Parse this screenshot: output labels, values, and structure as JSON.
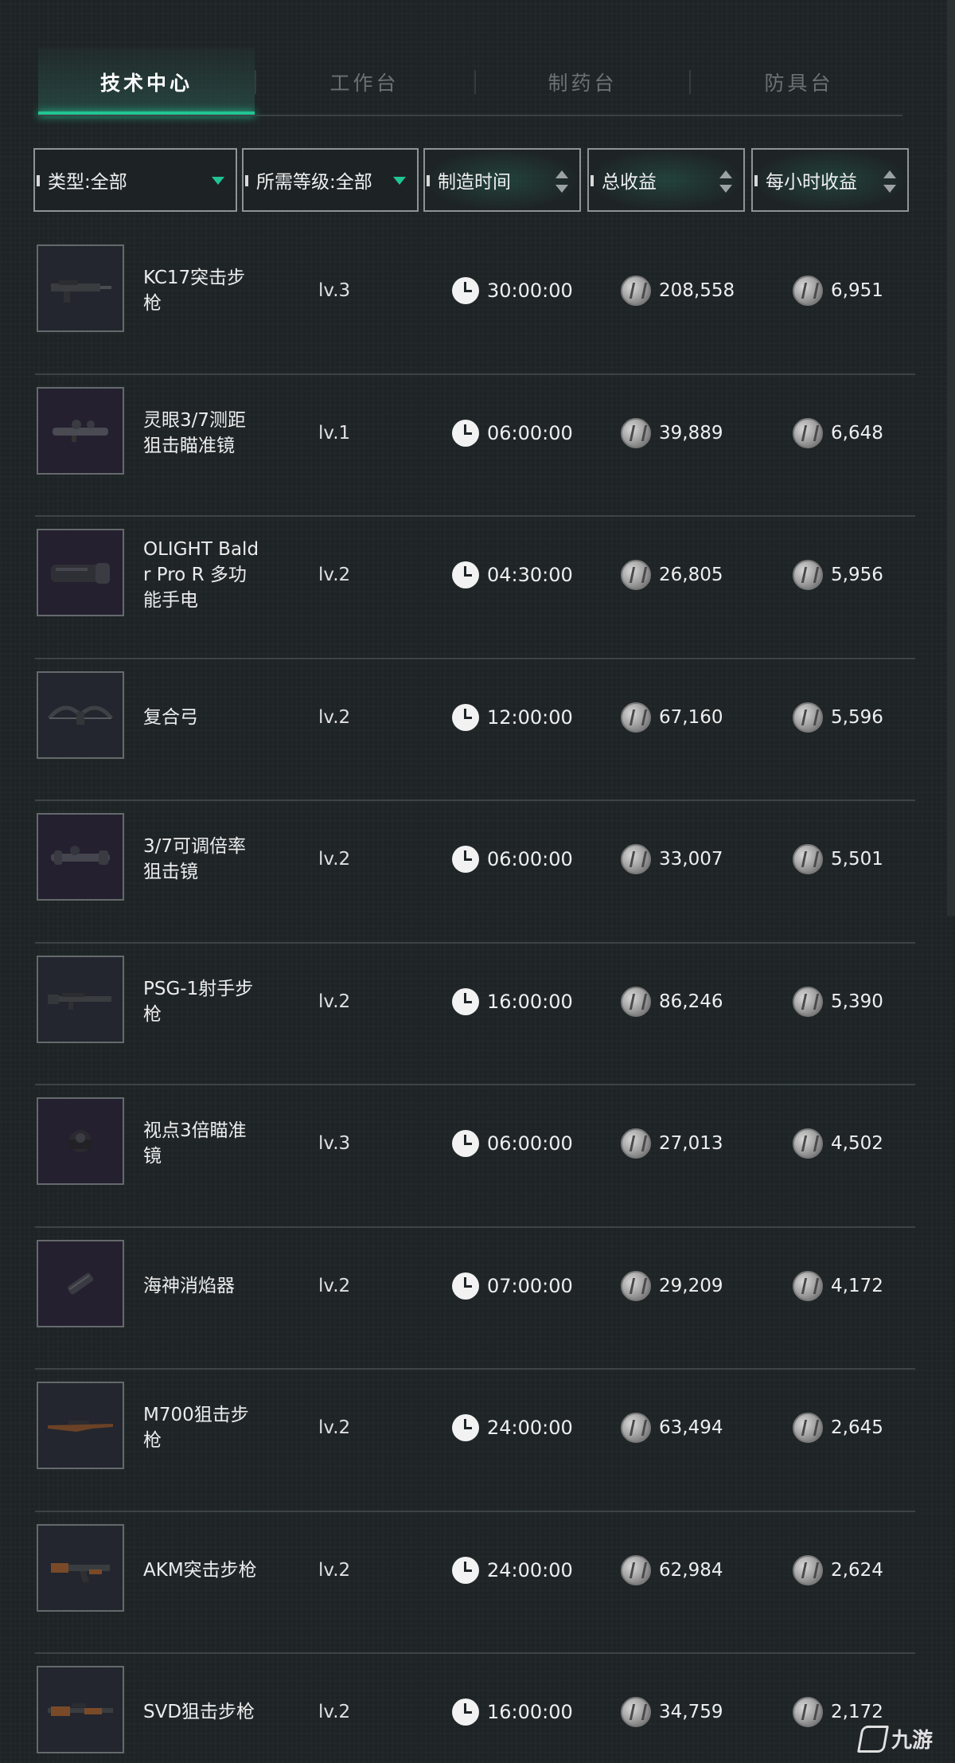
{
  "tabs": [
    {
      "label": "技术中心",
      "active": true
    },
    {
      "label": "工作台",
      "active": false
    },
    {
      "label": "制药台",
      "active": false
    },
    {
      "label": "防具台",
      "active": false
    }
  ],
  "filters": {
    "type": "类型:全部",
    "level": "所需等级:全部",
    "craft_time": "制造时间",
    "total_income": "总收益",
    "hourly_income": "每小时收益"
  },
  "accent_color": "#21c494",
  "items": [
    {
      "name": "KC17突击步枪",
      "level": "lv.3",
      "time": "30:00:00",
      "total": "208,558",
      "hourly": "6,951",
      "icon": "rifle-icon"
    },
    {
      "name": "灵眼3/7测距狙击瞄准镜",
      "level": "lv.1",
      "time": "06:00:00",
      "total": "39,889",
      "hourly": "6,648",
      "icon": "scope-icon"
    },
    {
      "name": "OLIGHT Baldr Pro R 多功能手电",
      "level": "lv.2",
      "time": "04:30:00",
      "total": "26,805",
      "hourly": "5,956",
      "icon": "flashlight-icon"
    },
    {
      "name": "复合弓",
      "level": "lv.2",
      "time": "12:00:00",
      "total": "67,160",
      "hourly": "5,596",
      "icon": "bow-icon"
    },
    {
      "name": "3/7可调倍率狙击镜",
      "level": "lv.2",
      "time": "06:00:00",
      "total": "33,007",
      "hourly": "5,501",
      "icon": "scope-icon"
    },
    {
      "name": "PSG-1射手步枪",
      "level": "lv.2",
      "time": "16:00:00",
      "total": "86,246",
      "hourly": "5,390",
      "icon": "rifle-icon"
    },
    {
      "name": "视点3倍瞄准镜",
      "level": "lv.3",
      "time": "06:00:00",
      "total": "27,013",
      "hourly": "4,502",
      "icon": "sight-icon"
    },
    {
      "name": "海神消焰器",
      "level": "lv.2",
      "time": "07:00:00",
      "total": "29,209",
      "hourly": "4,172",
      "icon": "suppressor-icon"
    },
    {
      "name": "M700狙击步枪",
      "level": "lv.2",
      "time": "24:00:00",
      "total": "63,494",
      "hourly": "2,645",
      "icon": "sniper-icon"
    },
    {
      "name": "AKM突击步枪",
      "level": "lv.2",
      "time": "24:00:00",
      "total": "62,984",
      "hourly": "2,624",
      "icon": "ak-icon"
    },
    {
      "name": "SVD狙击步枪",
      "level": "lv.2",
      "time": "16:00:00",
      "total": "34,759",
      "hourly": "2,172",
      "icon": "sniper-icon"
    }
  ],
  "watermark": "九游"
}
